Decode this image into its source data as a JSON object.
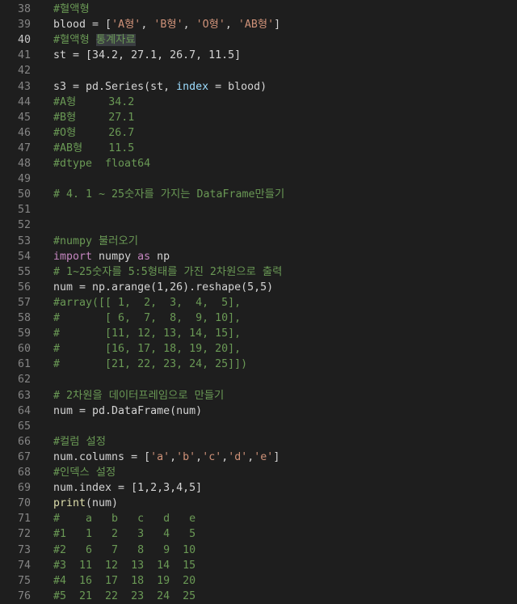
{
  "editor": {
    "current_line": 40,
    "highlight_text": "통계자료",
    "lines": [
      {
        "n": 38,
        "tokens": [
          {
            "t": "#혈액형",
            "c": "cm"
          }
        ]
      },
      {
        "n": 39,
        "tokens": [
          {
            "t": "blood = [",
            "c": "p"
          },
          {
            "t": "'A형'",
            "c": "str"
          },
          {
            "t": ", ",
            "c": "p"
          },
          {
            "t": "'B형'",
            "c": "str"
          },
          {
            "t": ", ",
            "c": "p"
          },
          {
            "t": "'O형'",
            "c": "str"
          },
          {
            "t": ", ",
            "c": "p"
          },
          {
            "t": "'AB형'",
            "c": "str"
          },
          {
            "t": "]",
            "c": "p"
          }
        ]
      },
      {
        "n": 40,
        "tokens": [
          {
            "t": "#혈액형 ",
            "c": "cm"
          },
          {
            "t": "통계자료",
            "c": "cm",
            "hl": true
          }
        ]
      },
      {
        "n": 41,
        "tokens": [
          {
            "t": "st = [34.2, 27.1, 26.7, 11.5]",
            "c": "p"
          }
        ]
      },
      {
        "n": 42,
        "tokens": []
      },
      {
        "n": 43,
        "tokens": [
          {
            "t": "s3 = pd.Series(st, ",
            "c": "p"
          },
          {
            "t": "index",
            "c": "var"
          },
          {
            "t": " = blood)",
            "c": "p"
          }
        ]
      },
      {
        "n": 44,
        "tokens": [
          {
            "t": "#A형     34.2",
            "c": "cm"
          }
        ]
      },
      {
        "n": 45,
        "tokens": [
          {
            "t": "#B형     27.1",
            "c": "cm"
          }
        ]
      },
      {
        "n": 46,
        "tokens": [
          {
            "t": "#O형     26.7",
            "c": "cm"
          }
        ]
      },
      {
        "n": 47,
        "tokens": [
          {
            "t": "#AB형    11.5",
            "c": "cm"
          }
        ]
      },
      {
        "n": 48,
        "tokens": [
          {
            "t": "#dtype  float64",
            "c": "cm"
          }
        ]
      },
      {
        "n": 49,
        "tokens": []
      },
      {
        "n": 50,
        "tokens": [
          {
            "t": "# 4. 1 ~ 25숫자를 가지는 DataFrame만들기",
            "c": "cm"
          }
        ]
      },
      {
        "n": 51,
        "tokens": []
      },
      {
        "n": 52,
        "tokens": []
      },
      {
        "n": 53,
        "tokens": [
          {
            "t": "#numpy 불러오기",
            "c": "cm"
          }
        ]
      },
      {
        "n": 54,
        "tokens": [
          {
            "t": "import",
            "c": "kw"
          },
          {
            "t": " numpy ",
            "c": "p"
          },
          {
            "t": "as",
            "c": "kw"
          },
          {
            "t": " np",
            "c": "p"
          }
        ]
      },
      {
        "n": 55,
        "tokens": [
          {
            "t": "# 1~25숫자를 5:5형태를 가진 2차원으로 출력",
            "c": "cm"
          }
        ]
      },
      {
        "n": 56,
        "tokens": [
          {
            "t": "num = np.arange(1,26).reshape(5,5)",
            "c": "p"
          }
        ]
      },
      {
        "n": 57,
        "tokens": [
          {
            "t": "#array([[ 1,  2,  3,  4,  5],",
            "c": "cm"
          }
        ]
      },
      {
        "n": 58,
        "tokens": [
          {
            "t": "#       [ 6,  7,  8,  9, 10],",
            "c": "cm"
          }
        ]
      },
      {
        "n": 59,
        "tokens": [
          {
            "t": "#       [11, 12, 13, 14, 15],",
            "c": "cm"
          }
        ]
      },
      {
        "n": 60,
        "tokens": [
          {
            "t": "#       [16, 17, 18, 19, 20],",
            "c": "cm"
          }
        ]
      },
      {
        "n": 61,
        "tokens": [
          {
            "t": "#       [21, 22, 23, 24, 25]])",
            "c": "cm"
          }
        ]
      },
      {
        "n": 62,
        "tokens": []
      },
      {
        "n": 63,
        "tokens": [
          {
            "t": "# 2차원을 데이터프레임으로 만들기",
            "c": "cm"
          }
        ]
      },
      {
        "n": 64,
        "tokens": [
          {
            "t": "num = pd.DataFrame(num)",
            "c": "p"
          }
        ]
      },
      {
        "n": 65,
        "tokens": []
      },
      {
        "n": 66,
        "tokens": [
          {
            "t": "#컬럼 설정",
            "c": "cm"
          }
        ]
      },
      {
        "n": 67,
        "tokens": [
          {
            "t": "num.columns = [",
            "c": "p"
          },
          {
            "t": "'a'",
            "c": "str"
          },
          {
            "t": ",",
            "c": "p"
          },
          {
            "t": "'b'",
            "c": "str"
          },
          {
            "t": ",",
            "c": "p"
          },
          {
            "t": "'c'",
            "c": "str"
          },
          {
            "t": ",",
            "c": "p"
          },
          {
            "t": "'d'",
            "c": "str"
          },
          {
            "t": ",",
            "c": "p"
          },
          {
            "t": "'e'",
            "c": "str"
          },
          {
            "t": "]",
            "c": "p"
          }
        ]
      },
      {
        "n": 68,
        "tokens": [
          {
            "t": "#인덱스 설정",
            "c": "cm"
          }
        ]
      },
      {
        "n": 69,
        "tokens": [
          {
            "t": "num.index = [1,2,3,4,5]",
            "c": "p"
          }
        ]
      },
      {
        "n": 70,
        "tokens": [
          {
            "t": "print",
            "c": "fn"
          },
          {
            "t": "(num)",
            "c": "p"
          }
        ]
      },
      {
        "n": 71,
        "tokens": [
          {
            "t": "#    a   b   c   d   e",
            "c": "cm"
          }
        ]
      },
      {
        "n": 72,
        "tokens": [
          {
            "t": "#1   1   2   3   4   5",
            "c": "cm"
          }
        ]
      },
      {
        "n": 73,
        "tokens": [
          {
            "t": "#2   6   7   8   9  10",
            "c": "cm"
          }
        ]
      },
      {
        "n": 74,
        "tokens": [
          {
            "t": "#3  11  12  13  14  15",
            "c": "cm"
          }
        ]
      },
      {
        "n": 75,
        "tokens": [
          {
            "t": "#4  16  17  18  19  20",
            "c": "cm"
          }
        ]
      },
      {
        "n": 76,
        "tokens": [
          {
            "t": "#5  21  22  23  24  25",
            "c": "cm"
          }
        ]
      }
    ]
  }
}
